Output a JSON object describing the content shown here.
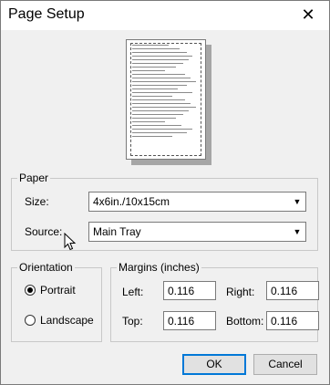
{
  "window": {
    "title": "Page Setup",
    "close_icon": "close-icon"
  },
  "preview": {
    "text_lines": 26
  },
  "paper": {
    "legend": "Paper",
    "size_label": "Size:",
    "size_value": "4x6in./10x15cm",
    "source_label": "Source:",
    "source_value": "Main Tray"
  },
  "orientation": {
    "legend": "Orientation",
    "portrait_label": "Portrait",
    "landscape_label": "Landscape",
    "selected": "Portrait"
  },
  "margins": {
    "legend": "Margins (inches)",
    "left_label": "Left:",
    "left_value": "0.116",
    "right_label": "Right:",
    "right_value": "0.116",
    "top_label": "Top:",
    "top_value": "0.116",
    "bottom_label": "Bottom:",
    "bottom_value": "0.116"
  },
  "buttons": {
    "ok": "OK",
    "cancel": "Cancel"
  }
}
